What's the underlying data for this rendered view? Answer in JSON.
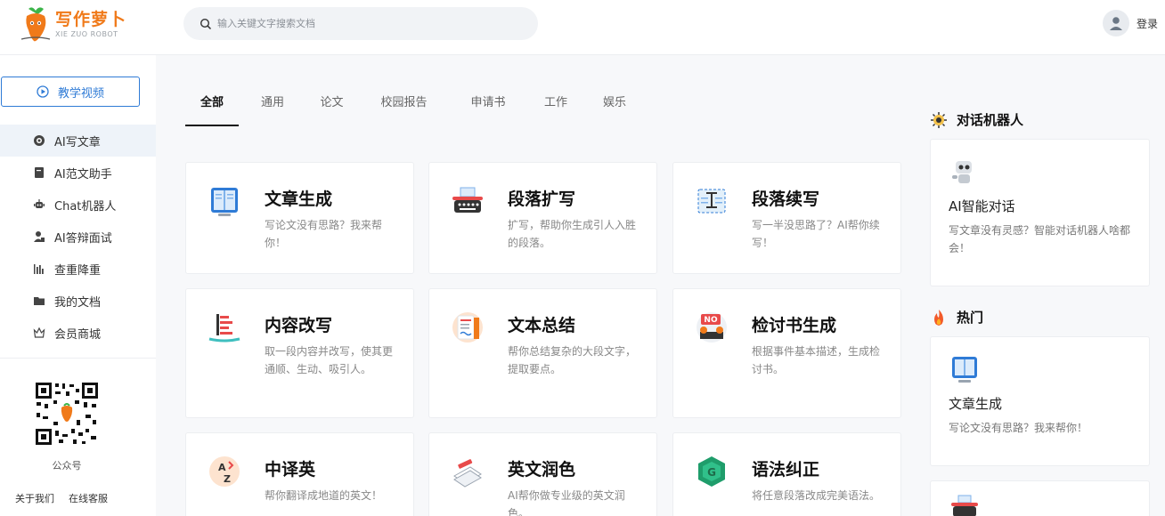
{
  "brand": {
    "name_cn": "写作萝卜",
    "name_en": "XIE ZUO ROBOT"
  },
  "colors": {
    "accent": "#2f7bd6",
    "brand_orange": "#f07a1a"
  },
  "search": {
    "placeholder": "输入关键文字搜索文档"
  },
  "user": {
    "login_label": "登录"
  },
  "sidebar": {
    "tutorial_label": "教学视频",
    "items": [
      {
        "label": "AI写文章",
        "icon": "ai-write-icon",
        "active": true
      },
      {
        "label": "AI范文助手",
        "icon": "book-icon",
        "active": false
      },
      {
        "label": "Chat机器人",
        "icon": "robot-icon",
        "active": false
      },
      {
        "label": "AI答辩面试",
        "icon": "interview-icon",
        "active": false
      },
      {
        "label": "查重降重",
        "icon": "chart-icon",
        "active": false
      },
      {
        "label": "我的文档",
        "icon": "folder-icon",
        "active": false
      },
      {
        "label": "会员商城",
        "icon": "crown-icon",
        "active": false
      }
    ],
    "qr_label": "公众号",
    "links": [
      "关于我们",
      "在线客服"
    ]
  },
  "tabs": [
    {
      "label": "全部",
      "active": true
    },
    {
      "label": "通用",
      "active": false
    },
    {
      "label": "论文",
      "active": false
    },
    {
      "label": "校园报告",
      "active": false
    },
    {
      "label": "申请书",
      "active": false
    },
    {
      "label": "工作",
      "active": false
    },
    {
      "label": "娱乐",
      "active": false
    }
  ],
  "cards": [
    {
      "title": "文章生成",
      "desc": "写论文没有思路？我来帮你！",
      "icon": "book-open-icon"
    },
    {
      "title": "段落扩写",
      "desc": "扩写，帮助你生成引人入胜的段落。",
      "icon": "typewriter-icon"
    },
    {
      "title": "段落续写",
      "desc": "写一半没思路了？AI帮你续写！",
      "icon": "text-cursor-icon"
    },
    {
      "title": "内容改写",
      "desc": "取一段内容并改写，使其更通顺、生动、吸引人。",
      "icon": "rewrite-icon"
    },
    {
      "title": "文本总结",
      "desc": "帮你总结复杂的大段文字，提取要点。",
      "icon": "summary-icon"
    },
    {
      "title": "检讨书生成",
      "desc": "根据事件基本描述，生成检讨书。",
      "icon": "no-sign-icon"
    },
    {
      "title": "中译英",
      "desc": "帮你翻译成地道的英文！",
      "icon": "translate-icon"
    },
    {
      "title": "英文润色",
      "desc": "AI帮你做专业级的英文润色。",
      "icon": "polish-icon"
    },
    {
      "title": "语法纠正",
      "desc": "将任意段落改成完美语法。",
      "icon": "grammar-icon"
    }
  ],
  "right_panel": {
    "chat_section_title": "对话机器人",
    "chat_card": {
      "title": "AI智能对话",
      "desc": "写文章没有灵感？智能对话机器人啥都会！"
    },
    "hot_section_title": "热门",
    "hot_card": {
      "title": "文章生成",
      "desc": "写论文没有思路？我来帮你！"
    }
  }
}
